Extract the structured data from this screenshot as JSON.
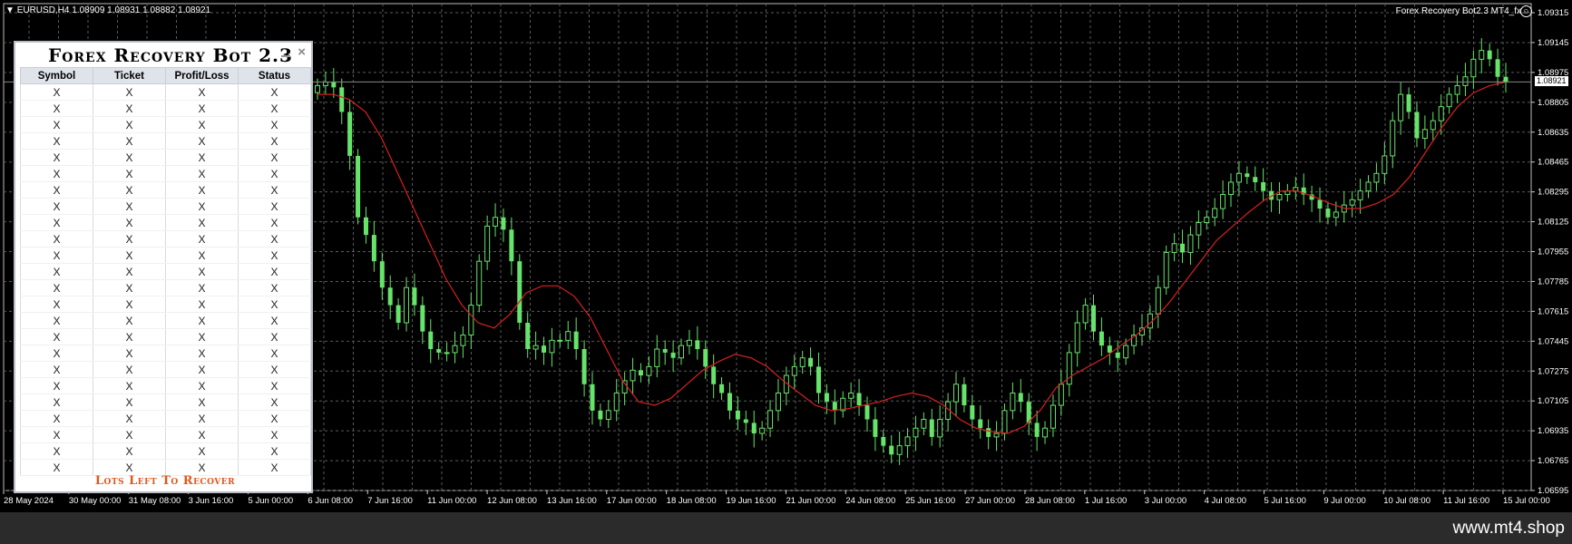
{
  "header": {
    "symbol_info": "EURUSD,H4  1.08909 1.08931 1.08882 1.08921",
    "ea_label": "Forex Recovery Bot2.3 MT4_fx",
    "current_price": "1.08921"
  },
  "panel": {
    "title": "Forex Recovery Bot 2.3",
    "close_glyph": "×",
    "columns": [
      "Symbol",
      "Ticket",
      "Profit/Loss",
      "Status"
    ],
    "rows": [
      [
        "X",
        "X",
        "X",
        "X"
      ],
      [
        "X",
        "X",
        "X",
        "X"
      ],
      [
        "X",
        "X",
        "X",
        "X"
      ],
      [
        "X",
        "X",
        "X",
        "X"
      ],
      [
        "X",
        "X",
        "X",
        "X"
      ],
      [
        "X",
        "X",
        "X",
        "X"
      ],
      [
        "X",
        "X",
        "X",
        "X"
      ],
      [
        "X",
        "X",
        "X",
        "X"
      ],
      [
        "X",
        "X",
        "X",
        "X"
      ],
      [
        "X",
        "X",
        "X",
        "X"
      ],
      [
        "X",
        "X",
        "X",
        "X"
      ],
      [
        "X",
        "X",
        "X",
        "X"
      ],
      [
        "X",
        "X",
        "X",
        "X"
      ],
      [
        "X",
        "X",
        "X",
        "X"
      ],
      [
        "X",
        "X",
        "X",
        "X"
      ],
      [
        "X",
        "X",
        "X",
        "X"
      ],
      [
        "X",
        "X",
        "X",
        "X"
      ],
      [
        "X",
        "X",
        "X",
        "X"
      ],
      [
        "X",
        "X",
        "X",
        "X"
      ],
      [
        "X",
        "X",
        "X",
        "X"
      ],
      [
        "X",
        "X",
        "X",
        "X"
      ],
      [
        "X",
        "X",
        "X",
        "X"
      ],
      [
        "X",
        "X",
        "X",
        "X"
      ],
      [
        "X",
        "X",
        "X",
        "X"
      ]
    ],
    "footer": "Lots Left To Recover"
  },
  "chart_data": {
    "type": "candlestick",
    "symbol": "EURUSD",
    "timeframe": "H4",
    "y_ticks": [
      "1.09315",
      "1.09145",
      "1.08975",
      "1.08805",
      "1.08635",
      "1.08465",
      "1.08295",
      "1.08125",
      "1.07955",
      "1.07785",
      "1.07615",
      "1.07445",
      "1.07275",
      "1.07105",
      "1.06935",
      "1.06765",
      "1.06595"
    ],
    "ylim": [
      1.06595,
      1.09315
    ],
    "x_ticks": [
      "28 May 2024",
      "30 May 00:00",
      "31 May 08:00",
      "3 Jun 16:00",
      "5 Jun 00:00",
      "6 Jun 08:00",
      "7 Jun 16:00",
      "11 Jun 00:00",
      "12 Jun 08:00",
      "13 Jun 16:00",
      "17 Jun 00:00",
      "18 Jun 08:00",
      "19 Jun 16:00",
      "21 Jun 00:00",
      "24 Jun 08:00",
      "25 Jun 16:00",
      "27 Jun 00:00",
      "28 Jun 08:00",
      "1 Jul 16:00",
      "3 Jul 00:00",
      "4 Jul 08:00",
      "5 Jul 16:00",
      "9 Jul 00:00",
      "10 Jul 08:00",
      "11 Jul 16:00",
      "15 Jul 00:00"
    ],
    "close_path": [
      1.089,
      1.0892,
      1.0889,
      1.0875,
      1.085,
      1.0815,
      1.0805,
      1.079,
      1.0775,
      1.0765,
      1.0755,
      1.0775,
      1.0765,
      1.075,
      1.074,
      1.0738,
      1.0738,
      1.0742,
      1.0748,
      1.0765,
      1.079,
      1.081,
      1.0815,
      1.0808,
      1.079,
      1.0755,
      1.074,
      1.0742,
      1.0738,
      1.0745,
      1.0745,
      1.075,
      1.074,
      1.072,
      1.0705,
      1.07,
      1.0705,
      1.0715,
      1.0722,
      1.0728,
      1.0725,
      1.073,
      1.074,
      1.0738,
      1.0735,
      1.0742,
      1.0745,
      1.074,
      1.073,
      1.072,
      1.0715,
      1.0705,
      1.07,
      1.0698,
      1.0692,
      1.0695,
      1.0705,
      1.0715,
      1.0725,
      1.073,
      1.0735,
      1.073,
      1.0715,
      1.071,
      1.0705,
      1.0712,
      1.0715,
      1.0708,
      1.07,
      1.069,
      1.0685,
      1.068,
      1.0685,
      1.069,
      1.0695,
      1.07,
      1.069,
      1.07,
      1.071,
      1.072,
      1.0708,
      1.07,
      1.0695,
      1.069,
      1.0692,
      1.0705,
      1.0715,
      1.071,
      1.0698,
      1.069,
      1.0695,
      1.0708,
      1.072,
      1.0738,
      1.0755,
      1.0765,
      1.075,
      1.0742,
      1.0738,
      1.0735,
      1.0742,
      1.0748,
      1.0752,
      1.076,
      1.0775,
      1.0795,
      1.08,
      1.0795,
      1.0805,
      1.0812,
      1.0815,
      1.082,
      1.0828,
      1.0835,
      1.084,
      1.0838,
      1.0835,
      1.083,
      1.0825,
      1.0828,
      1.083,
      1.0832,
      1.0828,
      1.0825,
      1.082,
      1.0815,
      1.0818,
      1.0822,
      1.0825,
      1.083,
      1.0835,
      1.084,
      1.085,
      1.087,
      1.0885,
      1.0875,
      1.086,
      1.0865,
      1.087,
      1.0878,
      1.0885,
      1.089,
      1.0895,
      1.0905,
      1.091,
      1.0905,
      1.0895,
      1.0892
    ],
    "ma_path": [
      1.0885,
      1.0885,
      1.0882,
      1.0875,
      1.086,
      1.084,
      1.082,
      1.08,
      1.078,
      1.0765,
      1.0755,
      1.0752,
      1.076,
      1.0772,
      1.0776,
      1.0776,
      1.077,
      1.0758,
      1.074,
      1.0722,
      1.071,
      1.0708,
      1.0712,
      1.072,
      1.0728,
      1.0733,
      1.0737,
      1.0735,
      1.073,
      1.0722,
      1.0715,
      1.0708,
      1.0705,
      1.0706,
      1.0708,
      1.071,
      1.0713,
      1.0715,
      1.0713,
      1.0708,
      1.07,
      1.0695,
      1.0693,
      1.0692,
      1.0696,
      1.0705,
      1.0718,
      1.0725,
      1.073,
      1.0735,
      1.0742,
      1.0748,
      1.0756,
      1.0766,
      1.0778,
      1.079,
      1.0802,
      1.081,
      1.0818,
      1.0825,
      1.083,
      1.083,
      1.0827,
      1.0823,
      1.082,
      1.082,
      1.0823,
      1.0828,
      1.0838,
      1.0852,
      1.0866,
      1.0878,
      1.0886,
      1.089,
      1.0892
    ],
    "grid": true
  },
  "watermark": "www.mt4.shop",
  "colors": {
    "background": "#000000",
    "grid": "#5a5a5a",
    "candle": "#66e36a",
    "ma_line": "#d92020",
    "panel_footer": "#e0571b"
  }
}
